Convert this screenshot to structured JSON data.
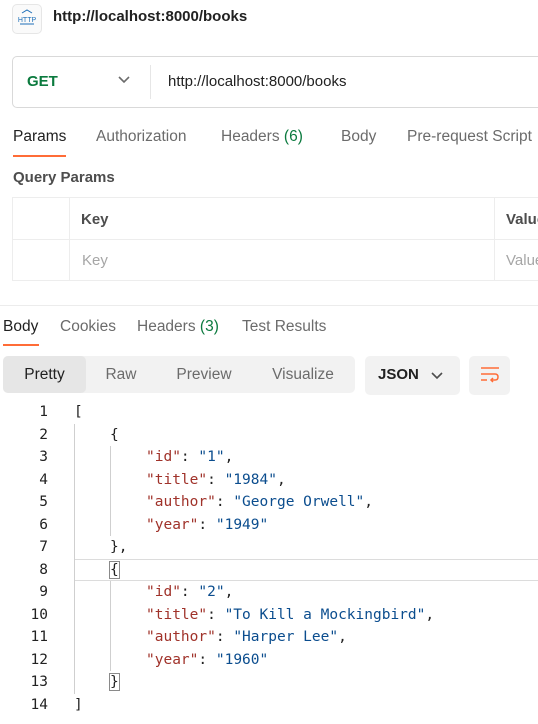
{
  "request": {
    "icon": "http-icon",
    "icon_text": "HTTP",
    "title": "http://localhost:8000/books",
    "method": "GET",
    "url": "http://localhost:8000/books"
  },
  "request_tabs": [
    {
      "label": "Params",
      "count": ""
    },
    {
      "label": "Authorization",
      "count": ""
    },
    {
      "label": "Headers",
      "count": "(6)"
    },
    {
      "label": "Body",
      "count": ""
    },
    {
      "label": "Pre-request Script",
      "count": ""
    }
  ],
  "query_params": {
    "title": "Query Params",
    "headers": {
      "key": "Key",
      "value": "Value"
    },
    "placeholders": {
      "key": "Key",
      "value": "Value"
    }
  },
  "response_tabs": [
    {
      "label": "Body",
      "count": ""
    },
    {
      "label": "Cookies",
      "count": ""
    },
    {
      "label": "Headers",
      "count": "(3)"
    },
    {
      "label": "Test Results",
      "count": ""
    }
  ],
  "view_modes": [
    "Pretty",
    "Raw",
    "Preview",
    "Visualize"
  ],
  "active_view": "Pretty",
  "format": "JSON",
  "colors": {
    "accent": "#ff6c37",
    "method": "#0b7a3e",
    "json_key": "#a0322a",
    "json_string": "#0b4d8e"
  },
  "code_lines": [
    {
      "n": "1",
      "indent": 0,
      "tokens": [
        {
          "t": "[",
          "c": "punc"
        }
      ]
    },
    {
      "n": "2",
      "indent": 1,
      "tokens": [
        {
          "t": "{",
          "c": "punc"
        }
      ]
    },
    {
      "n": "3",
      "indent": 2,
      "tokens": [
        {
          "t": "\"id\"",
          "c": "key"
        },
        {
          "t": ": ",
          "c": "punc"
        },
        {
          "t": "\"1\"",
          "c": "str"
        },
        {
          "t": ",",
          "c": "punc"
        }
      ]
    },
    {
      "n": "4",
      "indent": 2,
      "tokens": [
        {
          "t": "\"title\"",
          "c": "key"
        },
        {
          "t": ": ",
          "c": "punc"
        },
        {
          "t": "\"1984\"",
          "c": "str"
        },
        {
          "t": ",",
          "c": "punc"
        }
      ]
    },
    {
      "n": "5",
      "indent": 2,
      "tokens": [
        {
          "t": "\"author\"",
          "c": "key"
        },
        {
          "t": ": ",
          "c": "punc"
        },
        {
          "t": "\"George Orwell\"",
          "c": "str"
        },
        {
          "t": ",",
          "c": "punc"
        }
      ]
    },
    {
      "n": "6",
      "indent": 2,
      "tokens": [
        {
          "t": "\"year\"",
          "c": "key"
        },
        {
          "t": ": ",
          "c": "punc"
        },
        {
          "t": "\"1949\"",
          "c": "str"
        }
      ]
    },
    {
      "n": "7",
      "indent": 1,
      "tokens": [
        {
          "t": "}",
          "c": "punc"
        },
        {
          "t": ",",
          "c": "punc"
        }
      ]
    },
    {
      "n": "8",
      "indent": 1,
      "tokens": [
        {
          "t": "{",
          "c": "punc"
        }
      ]
    },
    {
      "n": "9",
      "indent": 2,
      "tokens": [
        {
          "t": "\"id\"",
          "c": "key"
        },
        {
          "t": ": ",
          "c": "punc"
        },
        {
          "t": "\"2\"",
          "c": "str"
        },
        {
          "t": ",",
          "c": "punc"
        }
      ]
    },
    {
      "n": "10",
      "indent": 2,
      "tokens": [
        {
          "t": "\"title\"",
          "c": "key"
        },
        {
          "t": ": ",
          "c": "punc"
        },
        {
          "t": "\"To Kill a Mockingbird\"",
          "c": "str"
        },
        {
          "t": ",",
          "c": "punc"
        }
      ]
    },
    {
      "n": "11",
      "indent": 2,
      "tokens": [
        {
          "t": "\"author\"",
          "c": "key"
        },
        {
          "t": ": ",
          "c": "punc"
        },
        {
          "t": "\"Harper Lee\"",
          "c": "str"
        },
        {
          "t": ",",
          "c": "punc"
        }
      ]
    },
    {
      "n": "12",
      "indent": 2,
      "tokens": [
        {
          "t": "\"year\"",
          "c": "key"
        },
        {
          "t": ": ",
          "c": "punc"
        },
        {
          "t": "\"1960\"",
          "c": "str"
        }
      ]
    },
    {
      "n": "13",
      "indent": 1,
      "tokens": [
        {
          "t": "}",
          "c": "punc"
        }
      ]
    },
    {
      "n": "14",
      "indent": 0,
      "tokens": [
        {
          "t": "]",
          "c": "punc"
        }
      ]
    }
  ]
}
